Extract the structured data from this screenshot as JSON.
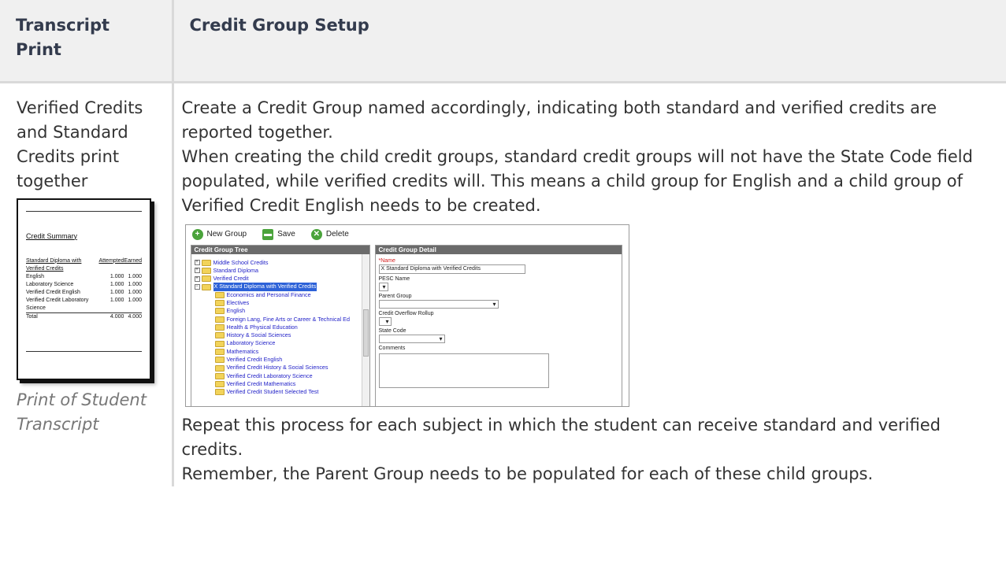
{
  "header": {
    "col1": "Transcript Print",
    "col2": "Credit Group Setup"
  },
  "row": {
    "print_label": "Verified Credits and Standard Credits print together",
    "caption": "Print of Student Transcript",
    "para1": "Create a Credit Group named accordingly, indicating both standard and verified credits are reported together.",
    "para2": "When creating the child credit groups, standard credit groups will not have the State Code field populated, while verified credits will. This means a child group for English and a child group of Verified Credit English needs to be created.",
    "para3": "Repeat this process for each subject in which the student can receive standard and verified credits.",
    "para4": "Remember, the Parent Group needs to be populated for each of these child groups."
  },
  "transcript": {
    "title": "Credit Summary",
    "columns": [
      "Standard Diploma with Verified Credits",
      "Attempted",
      "Earned"
    ],
    "rows": [
      [
        "English",
        "1.000",
        "1.000"
      ],
      [
        "Laboratory Science",
        "1.000",
        "1.000"
      ],
      [
        "Verified Credit English",
        "1.000",
        "1.000"
      ],
      [
        "Verified Credit Laboratory Science",
        "1.000",
        "1.000"
      ]
    ],
    "total": [
      "Total",
      "4.000",
      "4.000"
    ]
  },
  "screenshot": {
    "toolbar": {
      "new_group": "New Group",
      "save": "Save",
      "delete": "Delete"
    },
    "tree_title": "Credit Group Tree",
    "tree_top": [
      "Middle School Credits",
      "Standard Diploma",
      "Verified Credit"
    ],
    "tree_selected": "X Standard Diploma with Verified Credits",
    "tree_children": [
      "Economics and Personal Finance",
      "Electives",
      "English",
      "Foreign Lang, Fine Arts or Career & Technical Ed",
      "Health & Physical Education",
      "History & Social Sciences",
      "Laboratory Science",
      "Mathematics",
      "Verified Credit English",
      "Verified Credit History & Social Sciences",
      "Verified Credit Laboratory Science",
      "Verified Credit Mathematics",
      "Verified Credit Student Selected Test"
    ],
    "detail_title": "Credit Group Detail",
    "name_label": "*Name",
    "name_value": "X Standard Diploma with Verified Credits",
    "pesc_label": "PESC Name",
    "parent_label": "Parent Group",
    "overflow_label": "Credit Overflow Rollup",
    "state_label": "State Code",
    "comments_label": "Comments"
  }
}
